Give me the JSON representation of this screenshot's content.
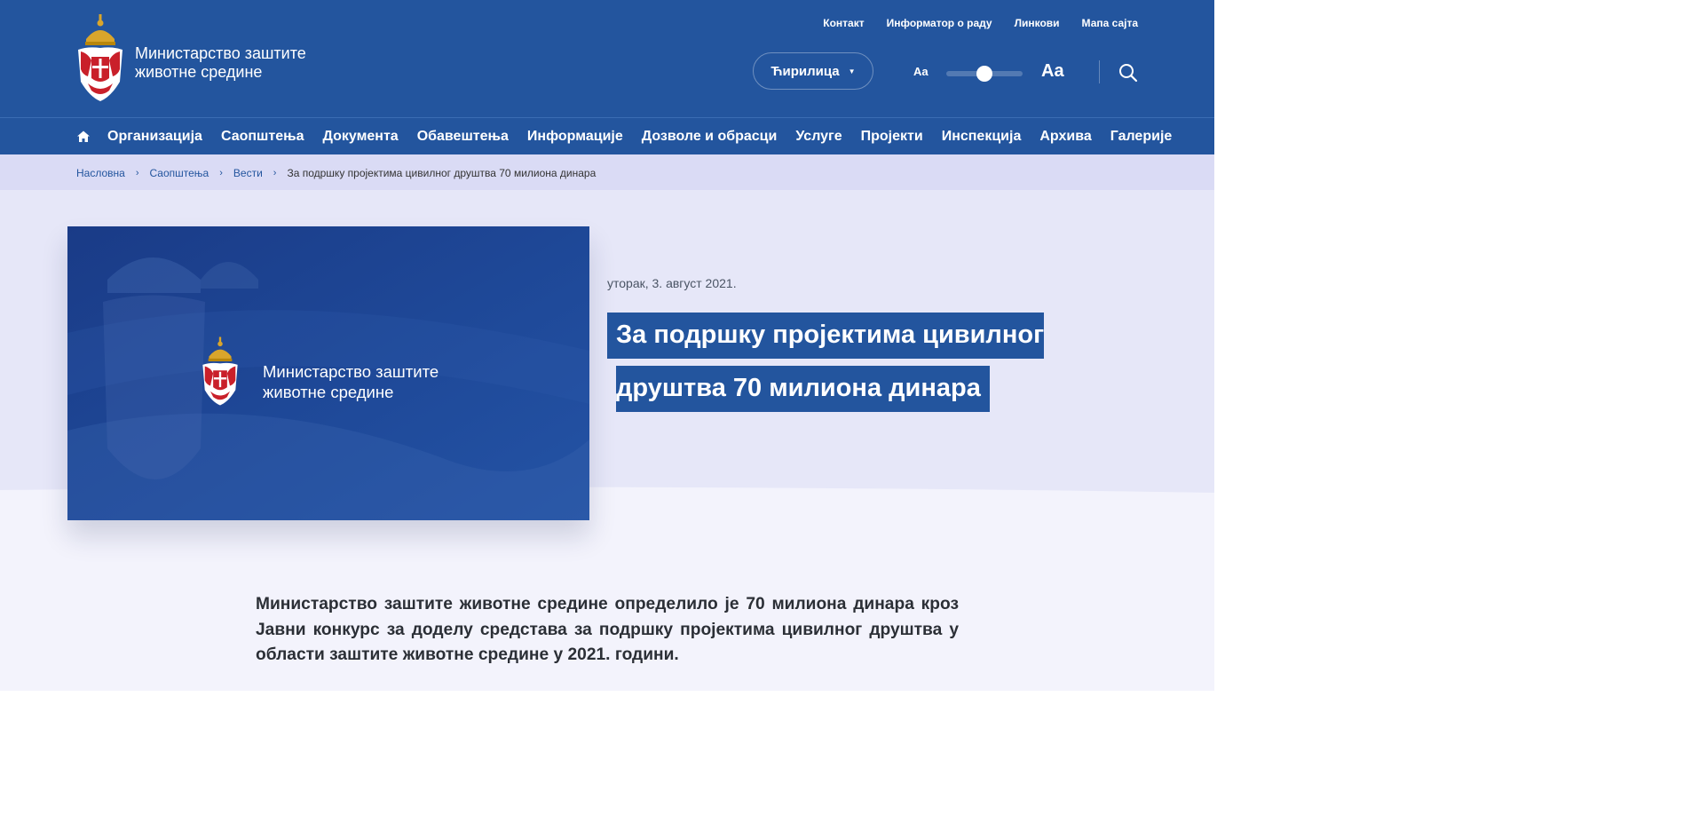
{
  "site": {
    "name_line1": "Министарство заштите",
    "name_line2": "животне средине"
  },
  "top_links": [
    "Контакт",
    "Информатор о раду",
    "Линкови",
    "Мапа сајта"
  ],
  "language": {
    "selected": "Ћирилица"
  },
  "font_size": {
    "small_label": "Aa",
    "large_label": "Aa",
    "level": 0.5
  },
  "nav": {
    "items": [
      "Организација",
      "Саопштења",
      "Документа",
      "Обавештења",
      "Информације",
      "Дозволе и обрасци",
      "Услуге",
      "Пројекти",
      "Инспекција",
      "Архива",
      "Галерије"
    ]
  },
  "breadcrumb": {
    "items": [
      "Насловна",
      "Саопштења",
      "Вести"
    ],
    "current": "За подршку пројектима цивилног друштва 70 милиона динара"
  },
  "article": {
    "date": "уторак, 3. август 2021.",
    "title_line1": "За подршку пројектима цивилног",
    "title_line2": "друштва 70 милиона динара",
    "lead": "Министарство заштите животне средине определило је 70 милиона динара кроз Јавни конкурс за доделу средстава за подршку пројектима цивилног друштва у области заштите животне средине у 2021. години."
  },
  "image": {
    "name_line1": "Министарство заштите",
    "name_line2": "животне средине"
  },
  "colors": {
    "header_blue": "#23559e",
    "breadcrumb_bg": "#dadbf5",
    "band_bg": "#e6e7f8",
    "page_bg": "#f3f3fc"
  }
}
